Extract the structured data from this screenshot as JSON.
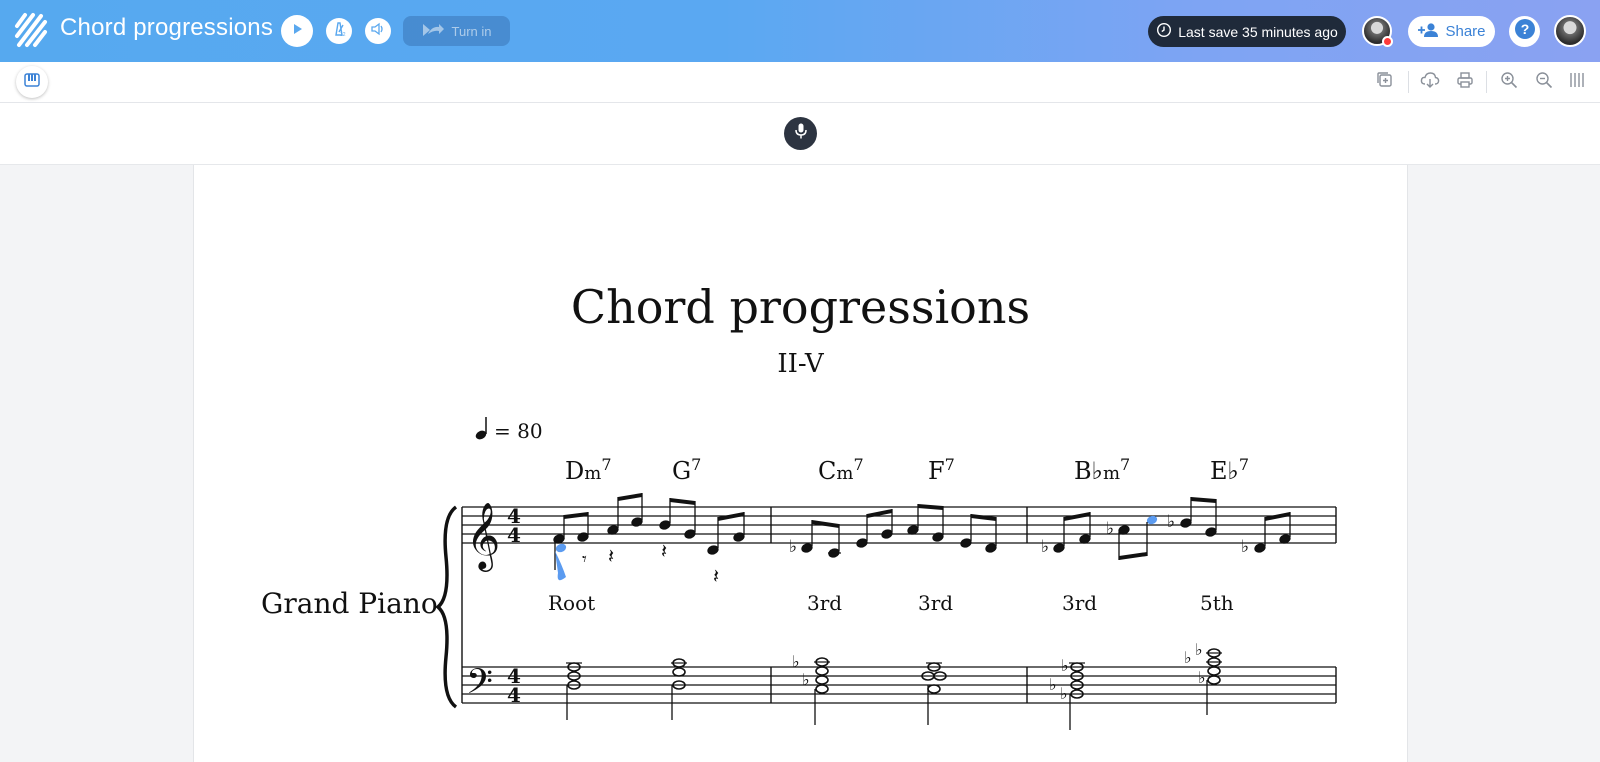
{
  "header": {
    "title": "Chord progressions",
    "turn_in_label": "Turn in",
    "last_save": "Last save 35 minutes ago",
    "share_label": "Share",
    "help_label": "?"
  },
  "score": {
    "title": "Chord progressions",
    "subtitle": "II-V",
    "tempo_value": "= 80",
    "instrument": "Grand Piano",
    "time_signature": [
      "4",
      "4"
    ],
    "chords": [
      {
        "root": "D",
        "quality": "m",
        "ext": "7"
      },
      {
        "root": "G",
        "quality": "",
        "ext": "7"
      },
      {
        "root": "C",
        "quality": "m",
        "ext": "7"
      },
      {
        "root": "F",
        "quality": "",
        "ext": "7"
      },
      {
        "root": "B♭",
        "quality": "m",
        "ext": "7"
      },
      {
        "root": "E♭",
        "quality": "",
        "ext": "7"
      }
    ],
    "lyrics": [
      "Root",
      "3rd",
      "3rd",
      "3rd",
      "5th"
    ]
  },
  "colors": {
    "topbar_start": "#56a9ef",
    "topbar_end": "#8aa2f2",
    "accent_blue": "#3b82d6",
    "dark_pill": "#1f2a3a",
    "note_highlight": "#5b9bf0"
  },
  "icons": [
    "logo-icon",
    "play-icon",
    "metronome-icon",
    "speaker-icon",
    "turn-in-icon",
    "clock-icon",
    "add-user-icon",
    "help-icon",
    "piano-keyboard-icon",
    "add-page-icon",
    "cloud-download-icon",
    "print-icon",
    "zoom-in-icon",
    "zoom-out-icon",
    "columns-icon",
    "microphone-icon"
  ]
}
